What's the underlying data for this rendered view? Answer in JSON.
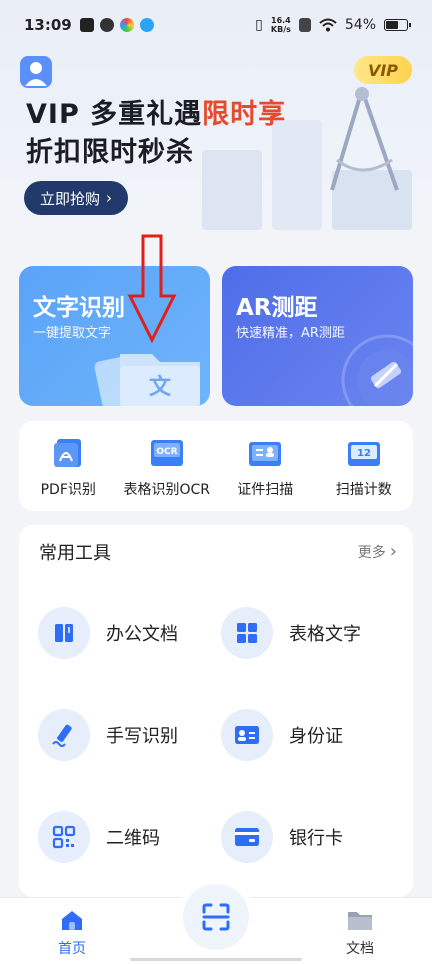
{
  "status_bar": {
    "time": "13:09",
    "net_speed_value": "16.4",
    "net_speed_unit": "KB/s",
    "battery": "54%",
    "battery_level": 0.54
  },
  "hero": {
    "vip_badge": "VIP",
    "title_prefix": "VIP 多重礼遇",
    "title_highlight": "限时享",
    "subtitle": "折扣限时秒杀",
    "buy_button": "立即抢购",
    "highlight_color": "#e54a2d"
  },
  "feature_cards": [
    {
      "title": "文字识别",
      "desc": "一键提取文字",
      "art_glyph": "文"
    },
    {
      "title": "AR测距",
      "desc": "快速精准，AR测距"
    }
  ],
  "quick_tools": [
    {
      "label": "PDF识别",
      "icon": "pdf-icon"
    },
    {
      "label": "表格识别OCR",
      "icon": "table-ocr-icon",
      "icon_text": "OCR"
    },
    {
      "label": "证件扫描",
      "icon": "id-scan-icon"
    },
    {
      "label": "扫描计数",
      "icon": "count-scan-icon",
      "icon_text": "12"
    }
  ],
  "common_tools": {
    "title": "常用工具",
    "more": "更多",
    "items": [
      {
        "label": "办公文档",
        "icon": "office-doc-icon"
      },
      {
        "label": "表格文字",
        "icon": "grid-table-icon"
      },
      {
        "label": "手写识别",
        "icon": "handwriting-icon"
      },
      {
        "label": "身份证",
        "icon": "id-card-icon"
      },
      {
        "label": "二维码",
        "icon": "qr-code-icon"
      },
      {
        "label": "银行卡",
        "icon": "bank-card-icon"
      }
    ]
  },
  "bottom_nav": {
    "home": "首页",
    "docs": "文档",
    "active": "home"
  },
  "colors": {
    "accent": "#2f6df6",
    "card_ocr": "#5aa3f7",
    "card_ar": "#4f6de8",
    "annotation_arrow": "#e0201b"
  }
}
